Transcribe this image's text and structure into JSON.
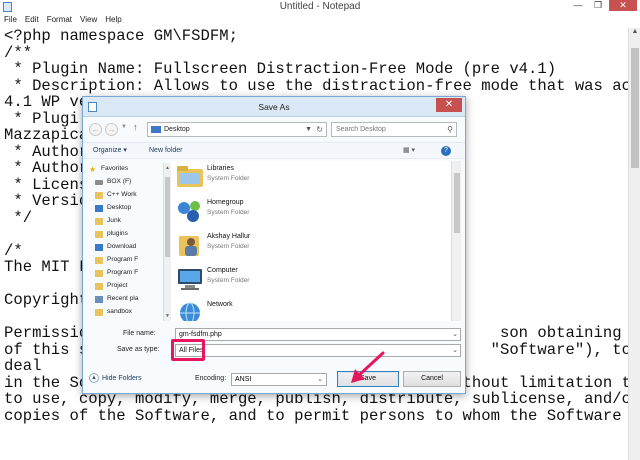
{
  "notepad": {
    "title": "Untitled - Notepad",
    "menu": [
      "File",
      "Edit",
      "Format",
      "View",
      "Help"
    ],
    "lines": [
      "<?php namespace GM\\FSDFM;",
      "/**",
      " * Plugin Name: Fullscreen Distraction-Free Mode (pre v4.1)",
      " * Description: Allows to use the distraction-free mode that was active pre",
      "4.1 WP ve",
      " * Plugi",
      "Mazzapica",
      " * Author",
      " * Author",
      " * Licens",
      " * Versic",
      " */",
      "",
      "/*",
      "The MIT L",
      "",
      "Copyright",
      "",
      "Permissio                                            son obtaining a copy",
      "of this s                                           \"Software\"), to",
      "deal",
      "in the Software without restriction, including without limitation the rights",
      "to use, copy, modify, merge, publish, distribute, sublicense, and/or sell",
      "copies of the Software, and to permit persons to whom the Software is"
    ]
  },
  "dialog": {
    "title": "Save As",
    "close_label": "✕",
    "address": {
      "location": "Desktop",
      "search_placeholder": "Search Desktop"
    },
    "commands": {
      "organize": "Organize ▾",
      "new_folder": "New folder",
      "help": "?"
    },
    "nav_items": [
      {
        "label": "Favorites",
        "icon": "star-icon"
      },
      {
        "label": "BOX (F)",
        "icon": "drive-icon"
      },
      {
        "label": "C++ Work",
        "icon": "folder-icon"
      },
      {
        "label": "Desktop",
        "icon": "desktop-folder-icon"
      },
      {
        "label": "Junk",
        "icon": "folder-icon"
      },
      {
        "label": "plugins",
        "icon": "folder-icon"
      },
      {
        "label": "Download",
        "icon": "download-folder-icon"
      },
      {
        "label": "Program F",
        "icon": "folder-icon"
      },
      {
        "label": "Program F",
        "icon": "folder-icon"
      },
      {
        "label": "Project",
        "icon": "folder-icon"
      },
      {
        "label": "Recent pla",
        "icon": "recent-places-icon"
      },
      {
        "label": "sandbox",
        "icon": "folder-icon"
      }
    ],
    "files": [
      {
        "name": "Libraries",
        "type": "System Folder",
        "icon": "libraries-icon"
      },
      {
        "name": "Homegroup",
        "type": "System Folder",
        "icon": "homegroup-icon"
      },
      {
        "name": "Akshay Hallur",
        "type": "System Folder",
        "icon": "user-folder-icon"
      },
      {
        "name": "Computer",
        "type": "System Folder",
        "icon": "computer-icon"
      },
      {
        "name": "Network",
        "type": "",
        "icon": "network-icon"
      }
    ],
    "file_name_label": "File name:",
    "file_name_value": "gm-fsdfm.php",
    "save_as_type_label": "Save as type:",
    "save_as_type_value": "All Files",
    "hide_folders": "Hide Folders",
    "encoding_label": "Encoding:",
    "encoding_value": "ANSI",
    "save_button": "Save",
    "cancel_button": "Cancel",
    "highlight_color": "#e8175d"
  }
}
